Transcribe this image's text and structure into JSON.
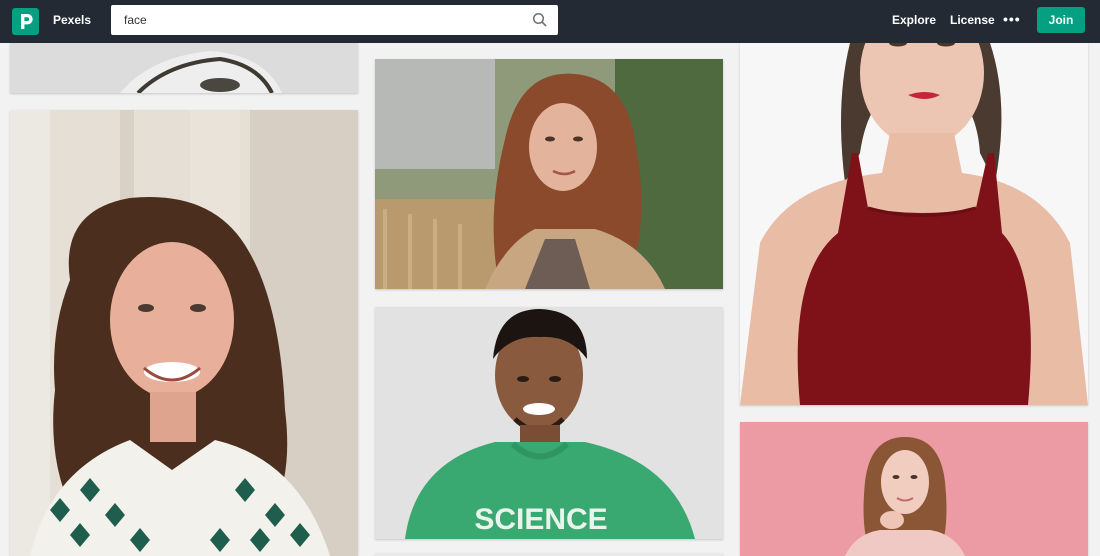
{
  "header": {
    "brand": "Pexels",
    "search": {
      "value": "face",
      "placeholder": ""
    },
    "nav": {
      "explore": "Explore",
      "license": "License"
    },
    "more_label": "•••",
    "join_label": "Join"
  },
  "icons": {
    "logo": "pexels-logo-icon",
    "search": "search-icon",
    "more": "more-dots-icon"
  },
  "colors": {
    "header_bg": "#232a34",
    "accent": "#05a081",
    "page_bg": "#f2f2f2"
  },
  "gallery": {
    "photos": [
      {
        "id": "photo-top-left-partial"
      },
      {
        "id": "photo-curly-hair-woman-smiling"
      },
      {
        "id": "photo-woman-red-hair-outdoors"
      },
      {
        "id": "photo-man-green-science-tshirt",
        "shirt_text": "SCIENCE"
      },
      {
        "id": "photo-woman-red-halter-top"
      },
      {
        "id": "photo-woman-pink-background"
      }
    ]
  }
}
